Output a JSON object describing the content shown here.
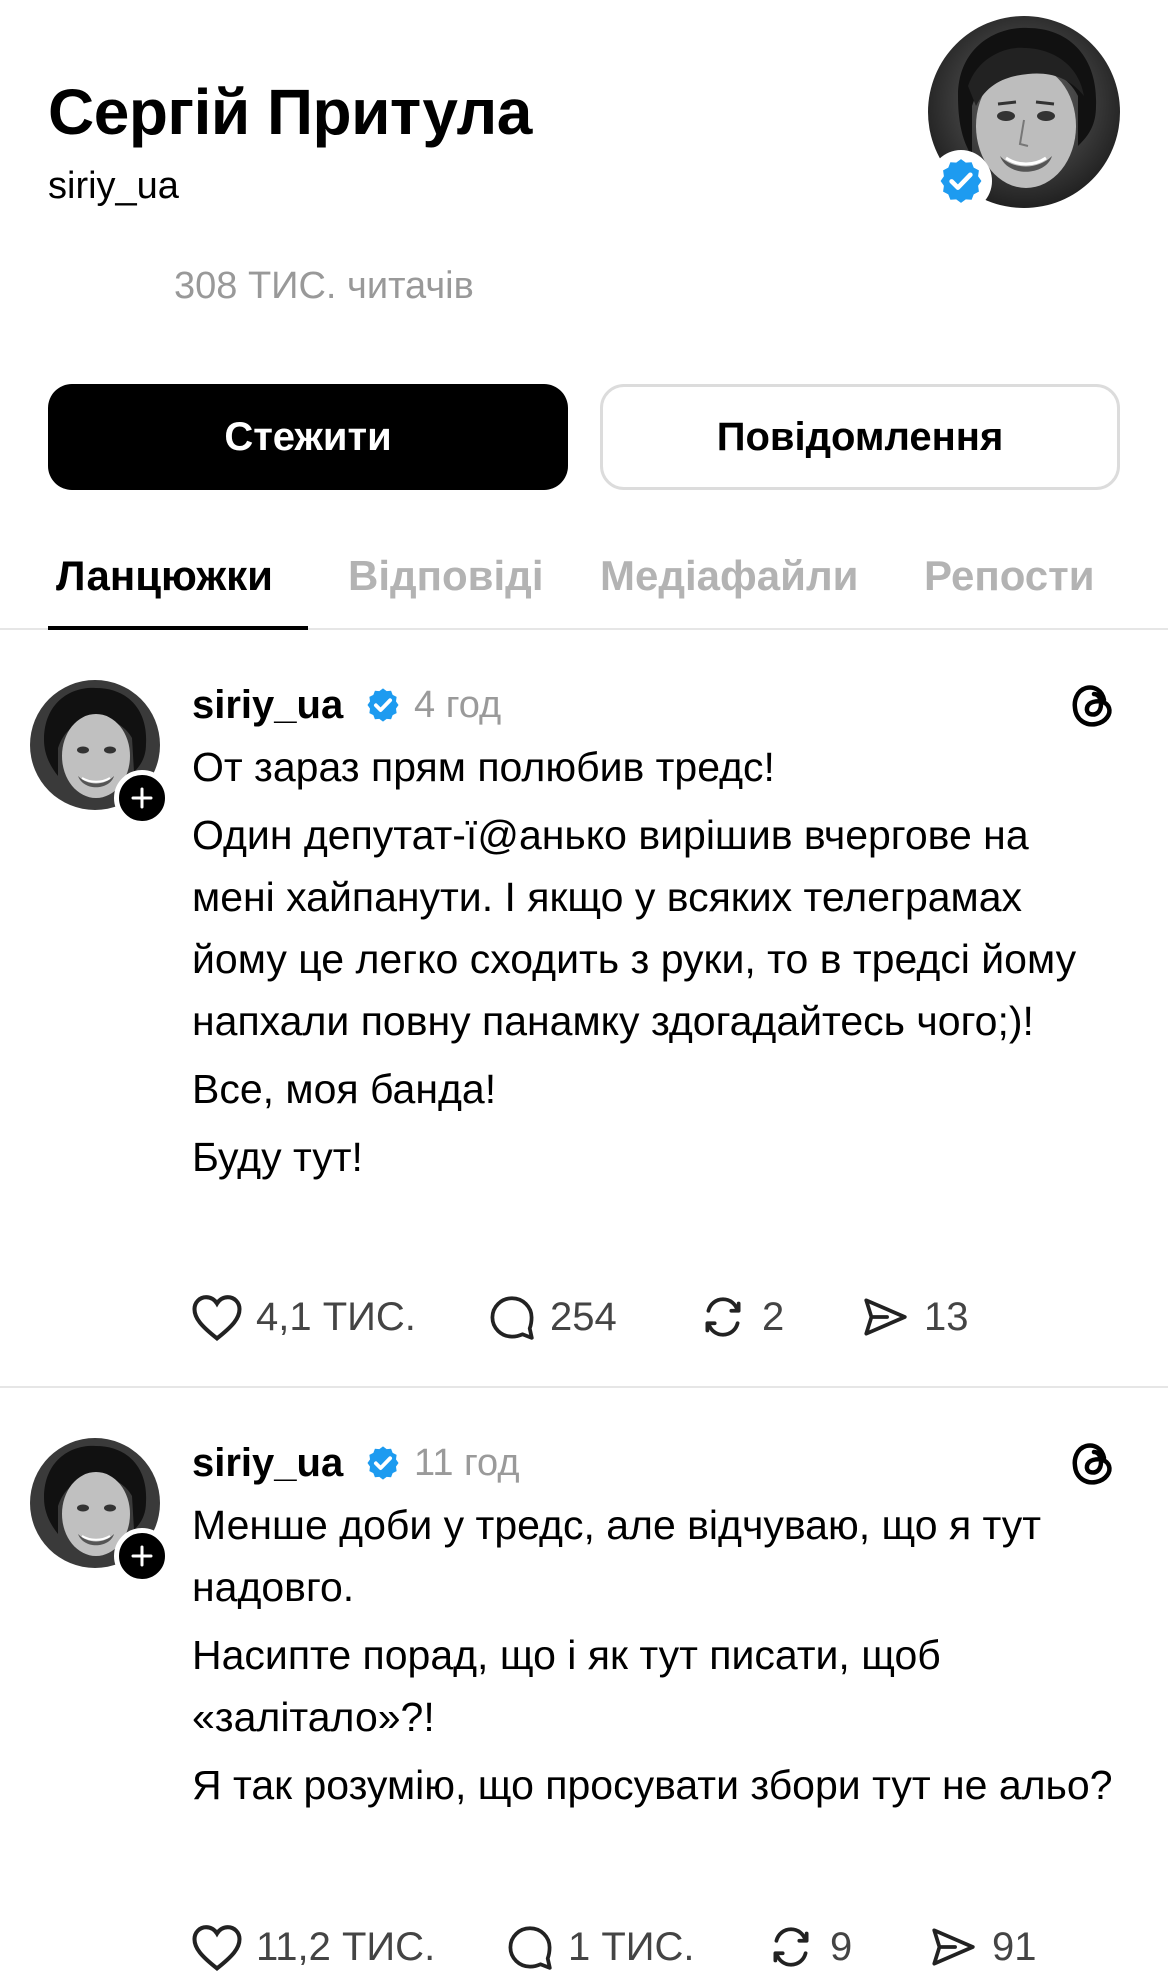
{
  "profile": {
    "name": "Сергій Притула",
    "handle": "siriy_ua",
    "followers": "308 ТИС. читачів"
  },
  "buttons": {
    "follow": "Стежити",
    "message": "Повідомлення"
  },
  "tabs": [
    {
      "label": "Ланцюжки",
      "active": true
    },
    {
      "label": "Відповіді",
      "active": false
    },
    {
      "label": "Медіафайли",
      "active": false
    },
    {
      "label": "Репости",
      "active": false
    }
  ],
  "posts": [
    {
      "author": "siriy_ua",
      "time": "4 год",
      "paragraphs": [
        "От зараз прям полюбив тредс!",
        "Один депутат-ї@анько вирішив вчергове на мені хайпанути. І якщо у всяких телеграмах йому це легко сходить з руки, то в тредсі йому напхали повну панамку здогадайтесь чого;)!",
        "Все, моя банда!",
        "Буду тут!"
      ],
      "likes": "4,1 ТИС.",
      "replies": "254",
      "reposts": "2",
      "shares": "13"
    },
    {
      "author": "siriy_ua",
      "time": "11 год",
      "paragraphs": [
        "Менше доби у тредс, але відчуваю, що я тут надовго.",
        "Насипте порад, що і як тут писати, щоб «залітало»?!",
        "Я так розумію, що просувати збори тут не альо?"
      ],
      "likes": "11,2 ТИС.",
      "replies": "1 ТИС.",
      "reposts": "9",
      "shares": "91"
    }
  ],
  "colors": {
    "verified": "#1d9bf0",
    "muted": "#999999",
    "divider": "#e6e6e6"
  }
}
